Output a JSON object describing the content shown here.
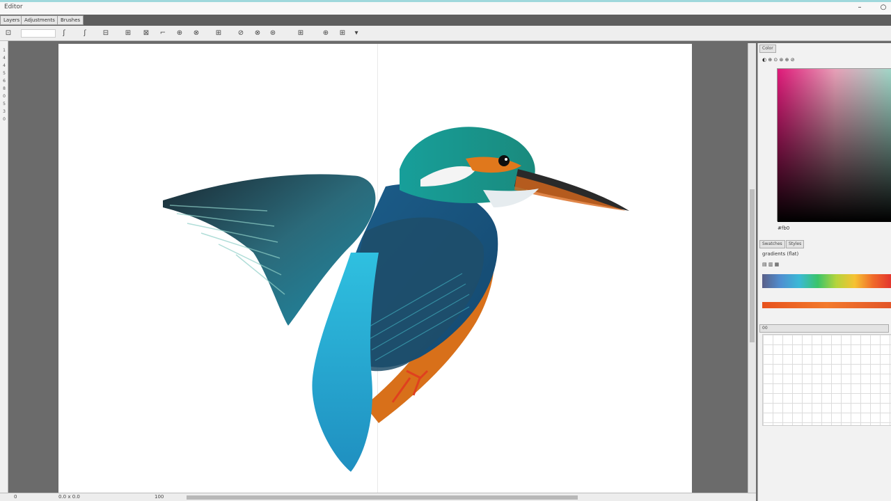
{
  "window": {
    "title": "Editor",
    "minimize": "–",
    "close": "○"
  },
  "tabs": [
    "Layers",
    "Adjustments",
    "Brushes"
  ],
  "toolbar": {
    "icons": [
      "new-file-icon",
      "open-icon",
      "brush-icon",
      "layers-icon",
      "crop-icon",
      "select-icon",
      "transform-icon",
      "rotate-icon",
      "layout-icon",
      "eyedropper-icon",
      "history-icon",
      "settings-icon",
      "align-icon",
      "grid-icon",
      "zoom-icon",
      "more-icon"
    ],
    "glyphs": [
      "⊡",
      "ʃ",
      "⊟",
      "⊞",
      "⊠",
      "⌐",
      "⊕",
      "⊗",
      "⊞",
      "⊘",
      "⊗",
      "⊛",
      "⊞",
      "⊕",
      "⊞",
      "▾"
    ]
  },
  "left_ruler": [
    "1",
    "4",
    "4",
    "5",
    "6",
    "8",
    "0",
    "5",
    "3",
    "0"
  ],
  "side_panel": {
    "top_tab": "Color",
    "bottom_tabs": [
      "Swatches",
      "Styles"
    ],
    "hex_value": "#fb0",
    "section_label": "gradients (flat)",
    "history_label": "00"
  },
  "status_bar": {
    "zoom": "0",
    "coords": "0.0 x 0.0",
    "size": "100"
  },
  "colors": {
    "accent": "#9fd8dc",
    "kingfisher_teal": "#1f9fb5",
    "kingfisher_orange": "#e07a1c"
  }
}
